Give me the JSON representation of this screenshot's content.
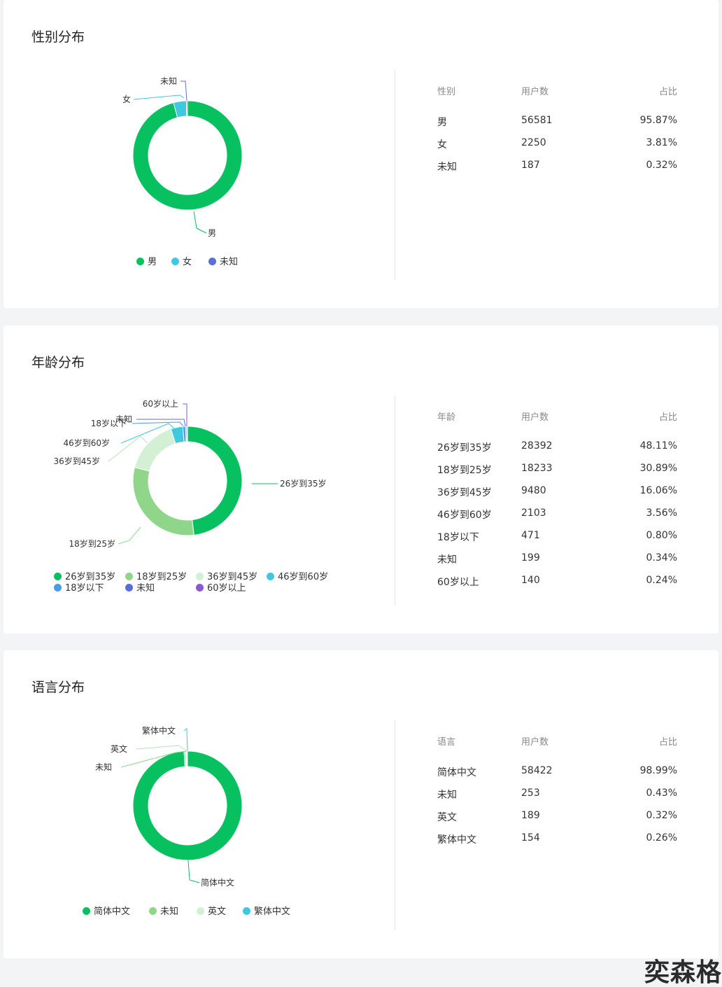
{
  "sections": [
    {
      "id": "gender",
      "title": "性别分布",
      "table": {
        "headers": [
          "性别",
          "用户数",
          "占比"
        ],
        "rows": [
          [
            "男",
            "56581",
            "95.87%"
          ],
          [
            "女",
            "2250",
            "3.81%"
          ],
          [
            "未知",
            "187",
            "0.32%"
          ]
        ]
      },
      "legend": [
        "男",
        "女",
        "未知"
      ]
    },
    {
      "id": "age",
      "title": "年龄分布",
      "table": {
        "headers": [
          "年龄",
          "用户数",
          "占比"
        ],
        "rows": [
          [
            "26岁到35岁",
            "28392",
            "48.11%"
          ],
          [
            "18岁到25岁",
            "18233",
            "30.89%"
          ],
          [
            "36岁到45岁",
            "9480",
            "16.06%"
          ],
          [
            "46岁到60岁",
            "2103",
            "3.56%"
          ],
          [
            "18岁以下",
            "471",
            "0.80%"
          ],
          [
            "未知",
            "199",
            "0.34%"
          ],
          [
            "60岁以上",
            "140",
            "0.24%"
          ]
        ]
      },
      "legend": [
        "26岁到35岁",
        "18岁到25岁",
        "36岁到45岁",
        "46岁到60岁",
        "18岁以下",
        "未知",
        "60岁以上"
      ]
    },
    {
      "id": "lang",
      "title": "语言分布",
      "table": {
        "headers": [
          "语言",
          "用户数",
          "占比"
        ],
        "rows": [
          [
            "简体中文",
            "58422",
            "98.99%"
          ],
          [
            "未知",
            "253",
            "0.43%"
          ],
          [
            "英文",
            "189",
            "0.32%"
          ],
          [
            "繁体中文",
            "154",
            "0.26%"
          ]
        ]
      },
      "legend": [
        "简体中文",
        "未知",
        "英文",
        "繁体中文"
      ]
    }
  ],
  "chart_data": [
    {
      "type": "pie",
      "categories": [
        "男",
        "女",
        "未知"
      ],
      "values": [
        56581,
        2250,
        187
      ],
      "colors": [
        "#07c160",
        "#40c8e0",
        "#5a6fd6"
      ],
      "legend_position": "bottom"
    },
    {
      "type": "pie",
      "categories": [
        "26岁到35岁",
        "18岁到25岁",
        "36岁到45岁",
        "46岁到60岁",
        "18岁以下",
        "未知",
        "60岁以上"
      ],
      "values": [
        28392,
        18233,
        9480,
        2103,
        471,
        199,
        140
      ],
      "colors": [
        "#07c160",
        "#8fd68b",
        "#d3f0d4",
        "#40c8e0",
        "#4a9be8",
        "#5a6fd6",
        "#8b59d0"
      ],
      "legend_position": "bottom"
    },
    {
      "type": "pie",
      "categories": [
        "简体中文",
        "未知",
        "英文",
        "繁体中文"
      ],
      "values": [
        58422,
        253,
        189,
        154
      ],
      "colors": [
        "#07c160",
        "#8fd68b",
        "#d3f0d4",
        "#40c8e0"
      ],
      "legend_position": "bottom"
    }
  ],
  "watermark": "奕森格"
}
